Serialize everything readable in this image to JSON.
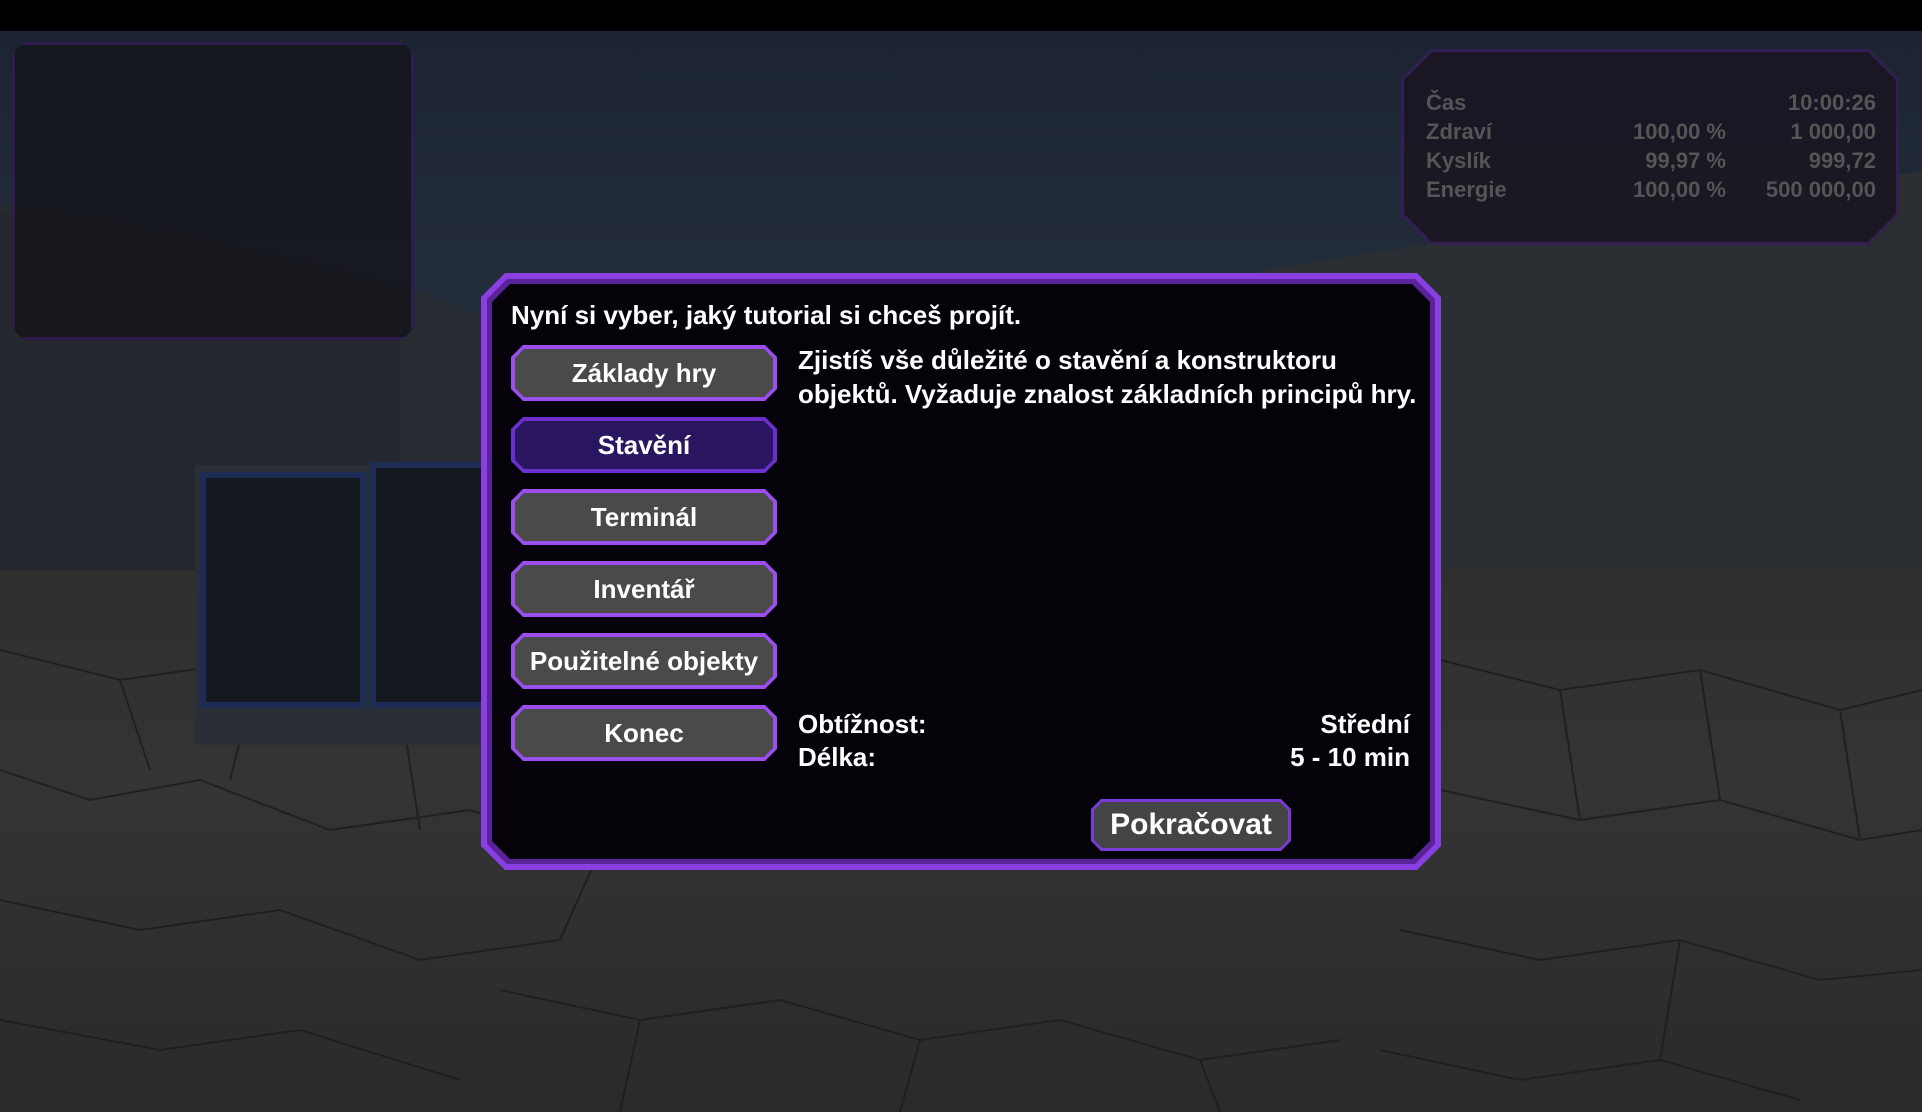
{
  "hud": {
    "stats": [
      {
        "label": "Čas",
        "percent": "",
        "value": "10:00:26"
      },
      {
        "label": "Zdraví",
        "percent": "100,00 %",
        "value": "1 000,00"
      },
      {
        "label": "Kyslík",
        "percent": "99,97 %",
        "value": "999,72"
      },
      {
        "label": "Energie",
        "percent": "100,00 %",
        "value": "500 000,00"
      }
    ]
  },
  "dialog": {
    "title": "Nyní si vyber, jaký tutorial si chceš projít.",
    "tutorials": [
      {
        "label": "Základy hry",
        "active": false
      },
      {
        "label": "Stavění",
        "active": true
      },
      {
        "label": "Terminál",
        "active": false
      },
      {
        "label": "Inventář",
        "active": false
      },
      {
        "label": "Použitelné objekty",
        "active": false
      },
      {
        "label": "Konec",
        "active": false
      }
    ],
    "description": "Zjistíš vše důležité o stavění a konstruktoru objektů. Vyžaduje znalost základních principů hry.",
    "difficulty_label": "Obtížnost:",
    "difficulty_value": "Střední",
    "length_label": "Délka:",
    "length_value": "5 - 10 min",
    "continue_label": "Pokračovat"
  },
  "colors": {
    "accent": "#8a3fe0",
    "button_bg": "#4a4a4a",
    "button_active_bg": "#2a1660"
  }
}
